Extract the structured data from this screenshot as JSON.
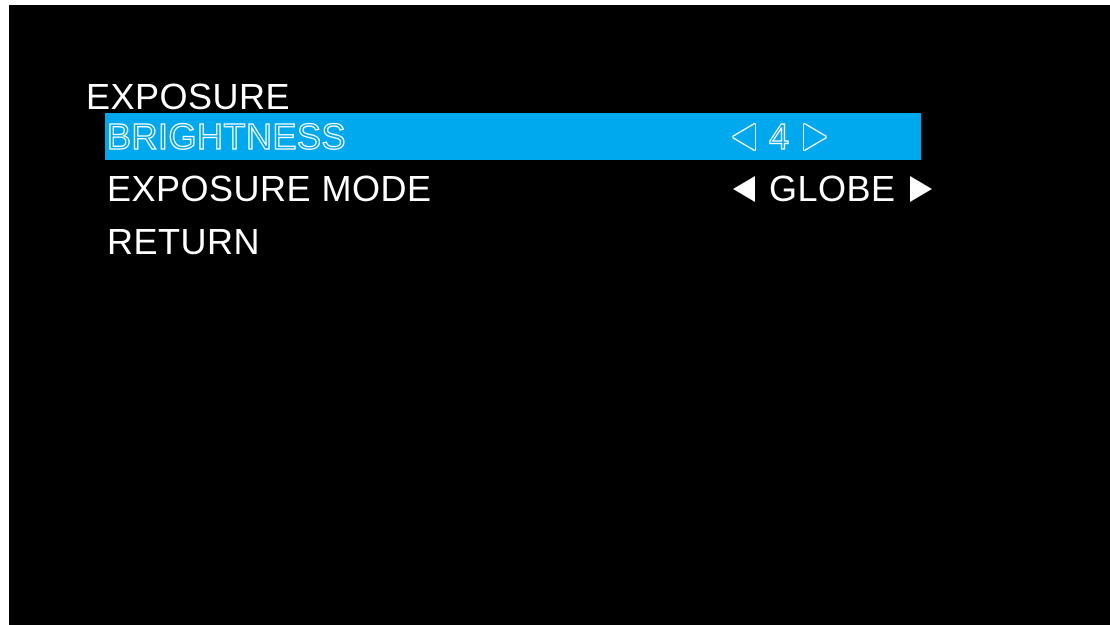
{
  "menu": {
    "title": "EXPOSURE",
    "items": [
      {
        "label": "BRIGHTNESS",
        "value": "4",
        "selected": true
      },
      {
        "label": "EXPOSURE MODE",
        "value": "GLOBE",
        "selected": false
      },
      {
        "label": "RETURN"
      }
    ]
  },
  "icons": {
    "decrease": "left-triangle-icon",
    "increase": "right-triangle-icon"
  },
  "colors": {
    "background": "#000000",
    "highlight": "#00a8ee",
    "text": "#ffffff"
  }
}
